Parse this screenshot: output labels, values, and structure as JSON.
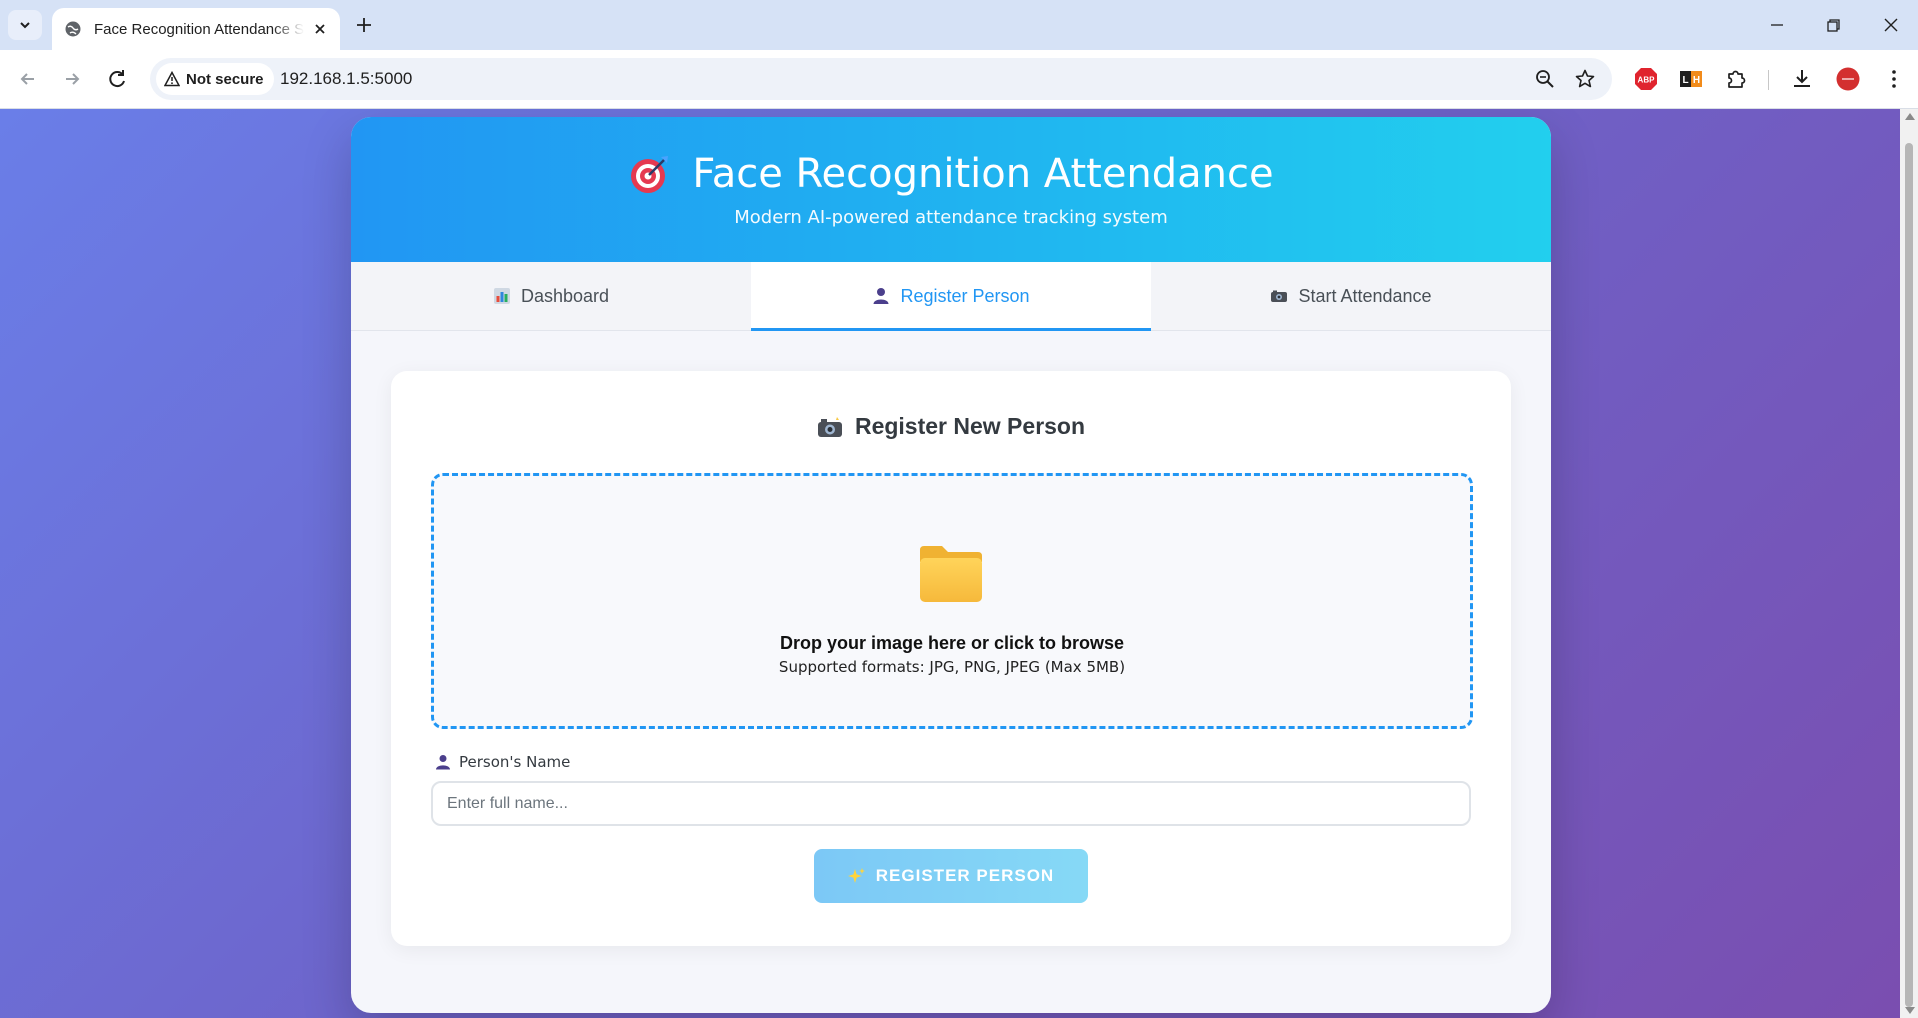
{
  "browser": {
    "tab_title": "Face Recognition Attendance System",
    "security_label": "Not secure",
    "url": "192.168.1.5:5000",
    "extensions": [
      "abp-icon",
      "lighthouse-icon",
      "puzzle-icon",
      "download-icon",
      "profile-avatar"
    ]
  },
  "header": {
    "title": "Face Recognition Attendance",
    "subtitle": "Modern AI-powered attendance tracking system"
  },
  "tabs": [
    {
      "label": "Dashboard",
      "icon": "bar-chart-icon",
      "active": false
    },
    {
      "label": "Register Person",
      "icon": "person-icon",
      "active": true
    },
    {
      "label": "Start Attendance",
      "icon": "camera-icon",
      "active": false
    }
  ],
  "register": {
    "title": "Register New Person",
    "dropzone_main": "Drop your image here or click to browse",
    "dropzone_sub": "Supported formats: JPG, PNG, JPEG (Max 5MB)",
    "name_label": "Person's Name",
    "name_placeholder": "Enter full name...",
    "name_value": "",
    "submit_label": "REGISTER PERSON"
  },
  "colors": {
    "accent": "#2196f3",
    "header_start": "#2196f3",
    "header_end": "#22cfee",
    "page_bg_start": "#6a7ee8",
    "page_bg_end": "#7a4eb0"
  }
}
